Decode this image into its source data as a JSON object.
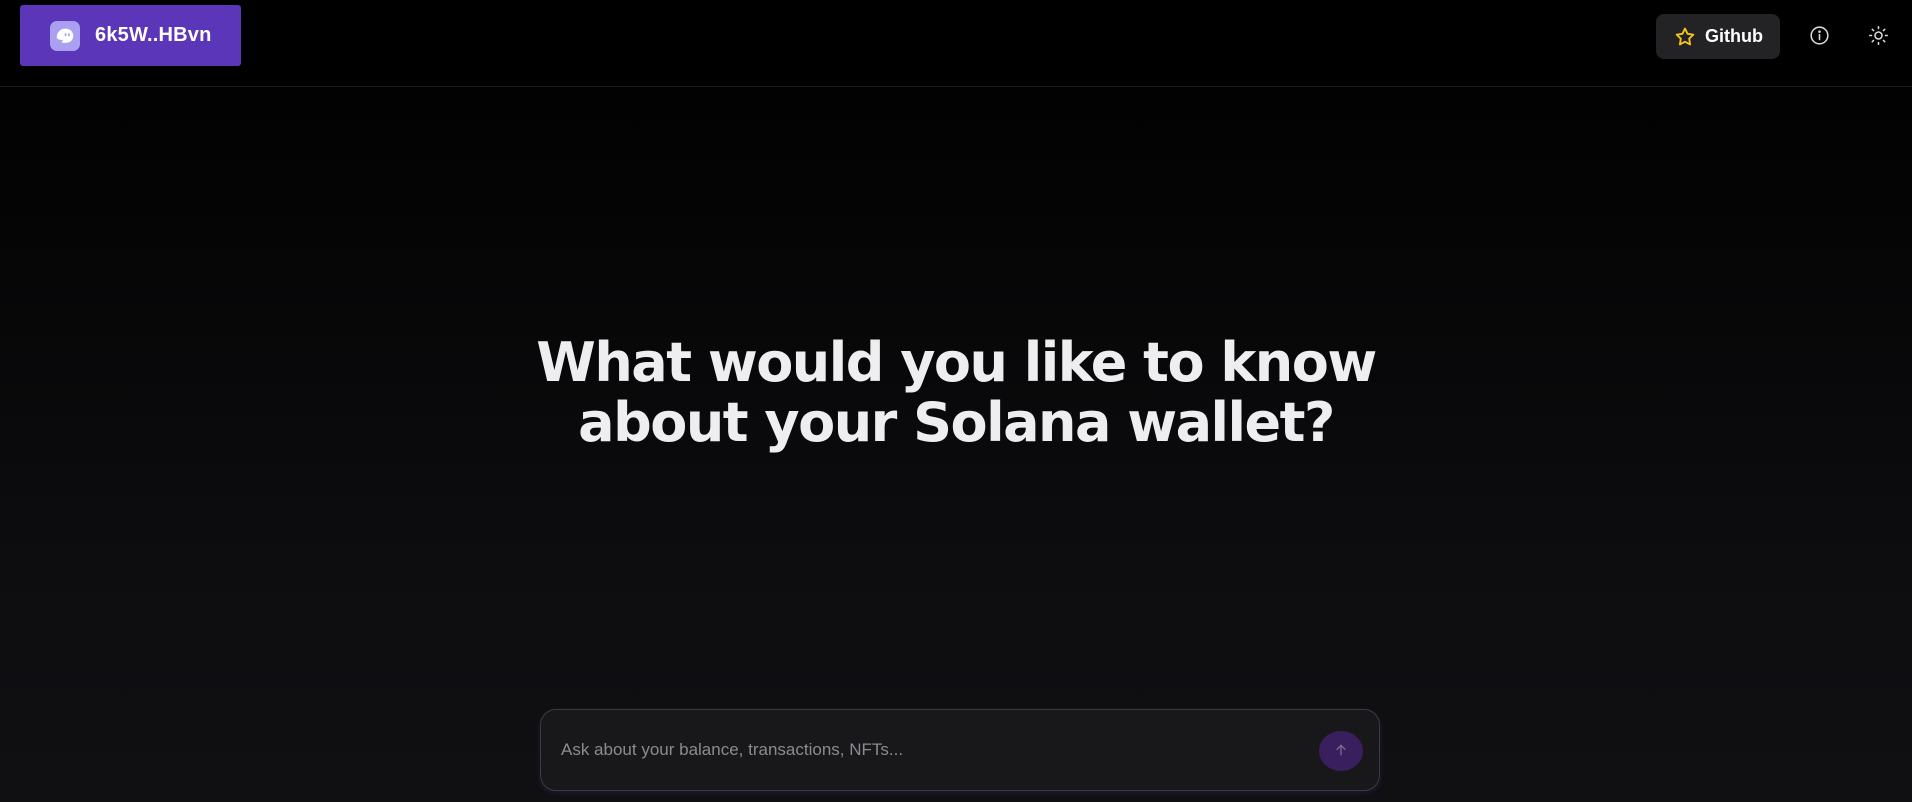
{
  "header": {
    "wallet": {
      "address": "6k5W..HBvn",
      "logo_icon": "phantom-ghost-icon",
      "accent": "#5b36b8"
    },
    "github": {
      "label": "Github",
      "icon": "star-icon",
      "star_color": "#f5c518"
    },
    "info_icon": "info-icon",
    "theme_icon": "sun-icon"
  },
  "hero": {
    "title": "What would you like to know\nabout your Solana wallet?"
  },
  "chat": {
    "placeholder": "Ask about your balance, transactions, NFTs...",
    "value": "",
    "send_icon": "arrow-up-icon",
    "send_color": "#3a1f5e"
  }
}
